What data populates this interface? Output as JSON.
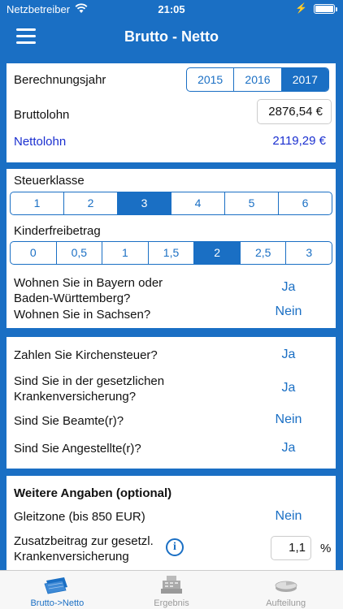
{
  "status": {
    "carrier": "Netzbetreiber",
    "time": "21:05"
  },
  "nav": {
    "title": "Brutto - Netto"
  },
  "section1": {
    "year_label": "Berechnungsjahr",
    "years": [
      "2015",
      "2016",
      "2017"
    ],
    "selected_year": "2017",
    "brutto_label": "Bruttolohn",
    "brutto_value": "2876,54 €",
    "netto_label": "Nettolohn",
    "netto_value": "2119,29 €"
  },
  "section2": {
    "steuerklasse_label": "Steuerklasse",
    "steuerklassen": [
      "1",
      "2",
      "3",
      "4",
      "5",
      "6"
    ],
    "selected_steuerklasse": "3",
    "kinder_label": "Kinderfreibetrag",
    "kinder_options": [
      "0",
      "0,5",
      "1",
      "1,5",
      "2",
      "2,5",
      "3"
    ],
    "selected_kinder": "2",
    "bayern_label_line1": "Wohnen Sie in Bayern oder",
    "bayern_label_line2": "Baden-Württemberg?",
    "bayern_value": "Ja",
    "sachsen_label": "Wohnen Sie in Sachsen?",
    "sachsen_value": "Nein"
  },
  "section3": {
    "kirche_label": "Zahlen Sie Kirchensteuer?",
    "kirche_value": "Ja",
    "kv_label_line1": "Sind Sie in der gesetzlichen",
    "kv_label_line2": "Krankenversicherung?",
    "kv_value": "Ja",
    "beamte_label": "Sind Sie Beamte(r)?",
    "beamte_value": "Nein",
    "angestellte_label": "Sind Sie Angestellte(r)?",
    "angestellte_value": "Ja"
  },
  "section4": {
    "heading": "Weitere Angaben (optional)",
    "gleitzone_label": "Gleitzone (bis 850 EUR)",
    "gleitzone_value": "Nein",
    "zusatz_label_line1": "Zusatzbeitrag zur gesetzl.",
    "zusatz_label_line2": "Krankenversicherung",
    "zusatz_value": "1,1",
    "zusatz_unit": "%"
  },
  "tabs": [
    {
      "label": "Brutto->Netto",
      "icon": "money-icon",
      "active": true
    },
    {
      "label": "Ergebnis",
      "icon": "cash-register-icon",
      "active": false
    },
    {
      "label": "Aufteilung",
      "icon": "pie-chart-icon",
      "active": false
    }
  ],
  "colors": {
    "primary": "#1a6fc4",
    "netto": "#1a2fd0",
    "inactive_tab": "#999999"
  }
}
